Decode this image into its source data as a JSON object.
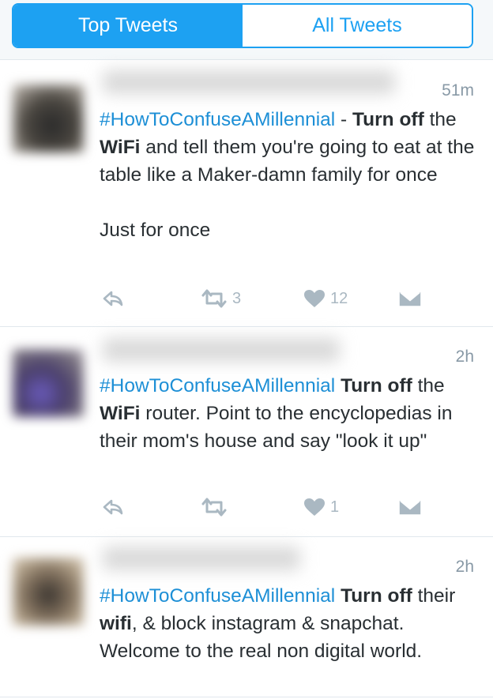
{
  "tabs": [
    {
      "label": "Top Tweets",
      "active": true
    },
    {
      "label": "All Tweets",
      "active": false
    }
  ],
  "colors": {
    "accent": "#1da1f2",
    "hashtag": "#1d8fd6",
    "muted": "#aab8c2",
    "text": "#292f33"
  },
  "icons": [
    "reply-icon",
    "retweet-icon",
    "heart-icon",
    "direct-message-icon"
  ],
  "tweets": [
    {
      "time": "51m",
      "segments": [
        {
          "text": "#HowToConfuseAMillennial",
          "style": "hashtag"
        },
        {
          "text": " - ",
          "style": "plain"
        },
        {
          "text": "Turn",
          "style": "bold"
        },
        {
          "text": " ",
          "style": "plain"
        },
        {
          "text": "off",
          "style": "bold"
        },
        {
          "text": " the ",
          "style": "plain"
        },
        {
          "text": "WiFi",
          "style": "bold"
        },
        {
          "text": " and tell them you're going to eat at the table like a Maker-damn family for once\n\nJust for once",
          "style": "plain"
        }
      ],
      "retweets": "3",
      "likes": "12"
    },
    {
      "time": "2h",
      "segments": [
        {
          "text": "#HowToConfuseAMillennial",
          "style": "hashtag"
        },
        {
          "text": " ",
          "style": "plain"
        },
        {
          "text": "Turn",
          "style": "bold"
        },
        {
          "text": " ",
          "style": "plain"
        },
        {
          "text": "off",
          "style": "bold"
        },
        {
          "text": " the ",
          "style": "plain"
        },
        {
          "text": "WiFi",
          "style": "bold"
        },
        {
          "text": " router. Point to the encyclopedias in their mom's house and say \"look it up\"",
          "style": "plain"
        }
      ],
      "retweets": "",
      "likes": "1"
    },
    {
      "time": "2h",
      "segments": [
        {
          "text": "#HowToConfuseAMillennial",
          "style": "hashtag"
        },
        {
          "text": " ",
          "style": "plain"
        },
        {
          "text": "Turn",
          "style": "bold"
        },
        {
          "text": " ",
          "style": "plain"
        },
        {
          "text": "off",
          "style": "bold"
        },
        {
          "text": " their ",
          "style": "plain"
        },
        {
          "text": "wifi",
          "style": "bold"
        },
        {
          "text": ", & block instagram & snapchat. Welcome to the real non digital world.",
          "style": "plain"
        }
      ],
      "retweets": "",
      "likes": ""
    }
  ]
}
